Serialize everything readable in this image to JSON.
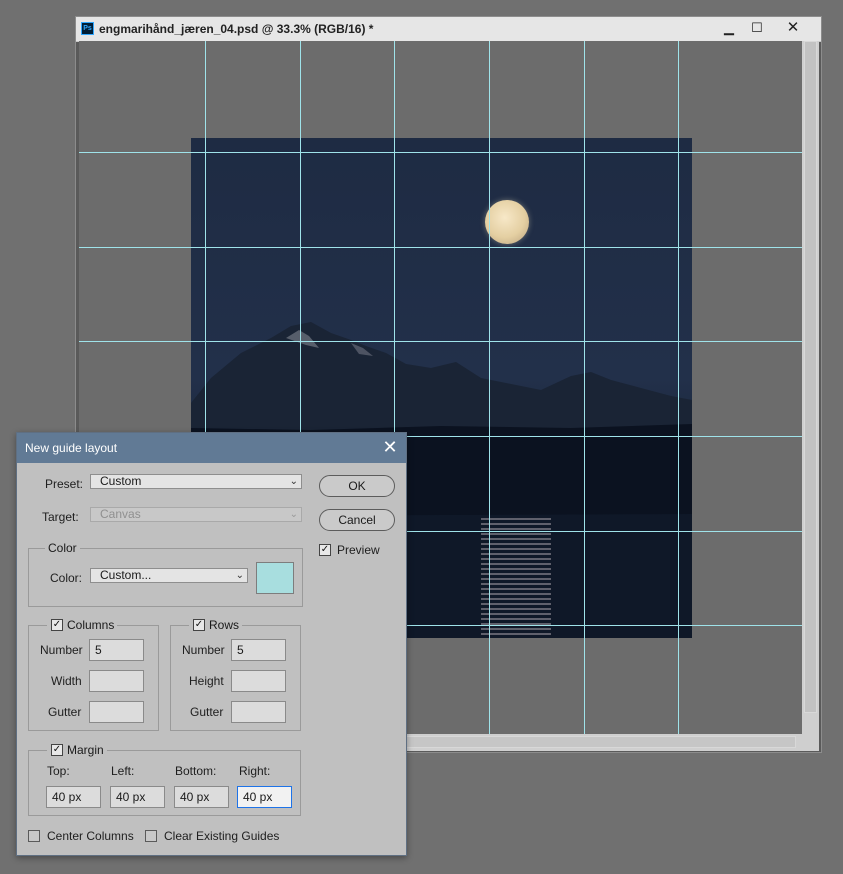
{
  "document": {
    "title": "engmarihånd_jæren_04.psd @ 33.3% (RGB/16) *",
    "app_badge": "Ps",
    "minimize": "▁",
    "maximize": "☐",
    "close": "✕",
    "guide_color": "#9fe3ea"
  },
  "dialog": {
    "title": "New guide layout",
    "close": "✕",
    "preset": {
      "label": "Preset:",
      "value": "Custom"
    },
    "target": {
      "label": "Target:",
      "value": "Canvas"
    },
    "color_group": {
      "title": "Color",
      "label": "Color:",
      "value": "Custom...",
      "swatch": "#a8dedf"
    },
    "ok": "OK",
    "cancel": "Cancel",
    "preview": {
      "label": "Preview",
      "checked": true
    },
    "columns": {
      "title": "Columns",
      "checked": true,
      "number_label": "Number",
      "number": "5",
      "width_label": "Width",
      "width": "",
      "gutter_label": "Gutter",
      "gutter": ""
    },
    "rows": {
      "title": "Rows",
      "checked": true,
      "number_label": "Number",
      "number": "5",
      "height_label": "Height",
      "height": "",
      "gutter_label": "Gutter",
      "gutter": ""
    },
    "margin": {
      "title": "Margin",
      "checked": true,
      "top_label": "Top:",
      "top": "40 px",
      "left_label": "Left:",
      "left": "40 px",
      "bottom_label": "Bottom:",
      "bottom": "40 px",
      "right_label": "Right:",
      "right": "40 px"
    },
    "center_columns": {
      "label": "Center Columns",
      "checked": false
    },
    "clear_guides": {
      "label": "Clear Existing Guides",
      "checked": false
    }
  }
}
